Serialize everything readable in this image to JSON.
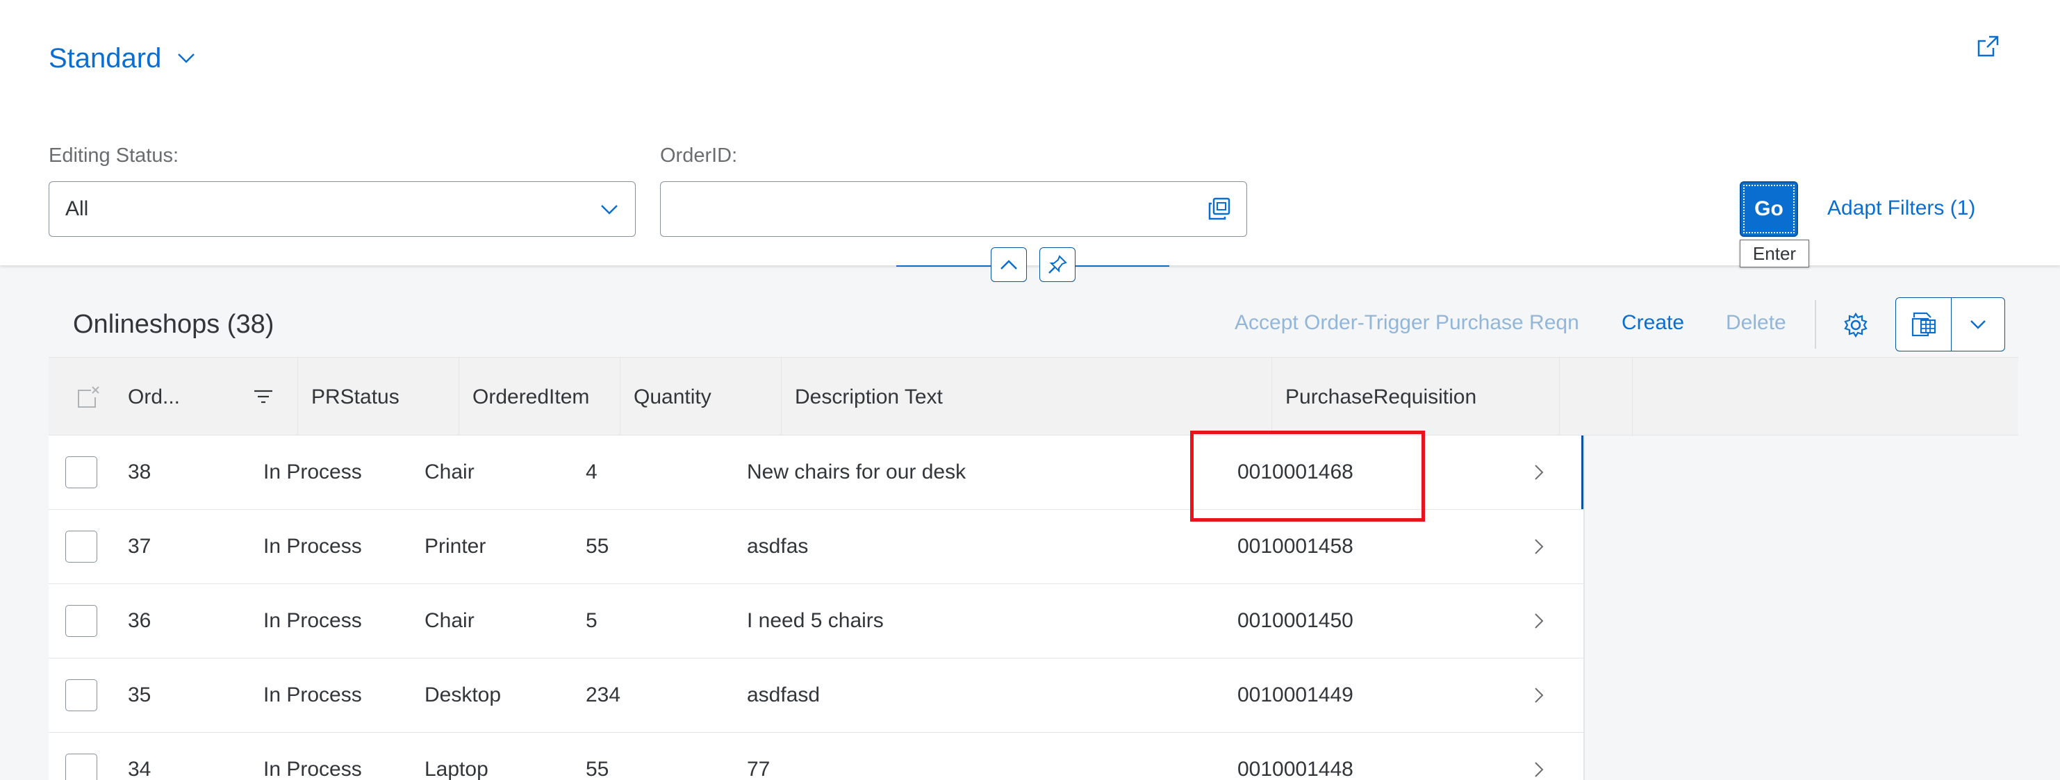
{
  "header": {
    "variant_title": "Standard",
    "icons": {
      "variant": "chevron-down-icon",
      "share": "share-icon"
    }
  },
  "filters": {
    "editing_status": {
      "label": "Editing Status:",
      "value": "All"
    },
    "order_id": {
      "label": "OrderID:",
      "value": "",
      "placeholder": ""
    },
    "go_label": "Go",
    "go_tooltip": "Enter",
    "adapt_filters_label": "Adapt Filters (1)"
  },
  "table": {
    "title": "Onlineshops (38)",
    "toolbar": {
      "accept_label": "Accept Order-Trigger Purchase Reqn",
      "create_label": "Create",
      "delete_label": "Delete"
    },
    "columns": [
      "Ord...",
      "PRStatus",
      "OrderedItem",
      "Quantity",
      "Description Text",
      "PurchaseRequisition"
    ],
    "rows": [
      {
        "order": "38",
        "status": "In Process",
        "item": "Chair",
        "quantity": "4",
        "description": "New chairs for our desk",
        "pr": "0010001468"
      },
      {
        "order": "37",
        "status": "In Process",
        "item": "Printer",
        "quantity": "55",
        "description": "asdfas",
        "pr": "0010001458"
      },
      {
        "order": "36",
        "status": "In Process",
        "item": "Chair",
        "quantity": "5",
        "description": "I need 5 chairs",
        "pr": "0010001450"
      },
      {
        "order": "35",
        "status": "In Process",
        "item": "Desktop",
        "quantity": "234",
        "description": "asdfasd",
        "pr": "0010001449"
      },
      {
        "order": "34",
        "status": "In Process",
        "item": "Laptop",
        "quantity": "55",
        "description": "77",
        "pr": "0010001448"
      }
    ]
  },
  "colors": {
    "accent": "#0a6ed1",
    "highlight": "#e8141b",
    "disabled": "#93b6d8"
  }
}
